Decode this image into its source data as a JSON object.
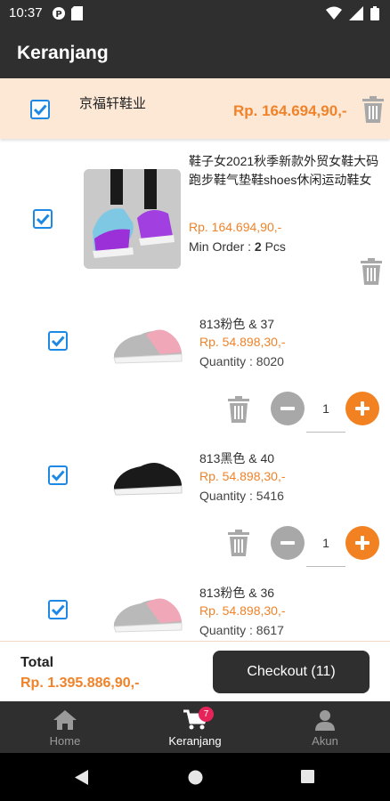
{
  "status_bar": {
    "time": "10:37"
  },
  "app_bar": {
    "title": "Keranjang"
  },
  "store": {
    "name": "京福轩鞋业",
    "subtotal": "Rp. 164.694,90,-"
  },
  "product": {
    "title": "鞋子女2021秋季新款外贸女鞋大码跑步鞋气垫鞋shoes休闲运动鞋女",
    "price": "Rp. 164.694,90,-",
    "min_order_label": "Min Order : ",
    "min_order_value": "2",
    "min_order_unit": " Pcs"
  },
  "variants": [
    {
      "name": "813粉色 & 37",
      "price": "Rp. 54.898,30,-",
      "quantity_label": "Quantity : 8020",
      "qty": "1",
      "color": "pink"
    },
    {
      "name": "813黑色 & 40",
      "price": "Rp. 54.898,30,-",
      "quantity_label": "Quantity : 5416",
      "qty": "1",
      "color": "black"
    },
    {
      "name": "813粉色 & 36",
      "price": "Rp. 54.898,30,-",
      "quantity_label": "Quantity : 8617",
      "color": "pink"
    }
  ],
  "footer": {
    "total_label": "Total",
    "total_value": "Rp. 1.395.886,90,-",
    "checkout_label": "Checkout (11)"
  },
  "bottom_nav": {
    "items": [
      {
        "label": "Home",
        "icon": "home-icon"
      },
      {
        "label": "Keranjang",
        "icon": "cart-icon",
        "badge": "7",
        "active": true
      },
      {
        "label": "Akun",
        "icon": "user-icon"
      }
    ]
  },
  "colors": {
    "accent": "#f0832a",
    "dark": "#2f2f2f",
    "checkbox": "#1e88e5",
    "store_bg": "#fde8d6",
    "badge": "#e6245a"
  }
}
